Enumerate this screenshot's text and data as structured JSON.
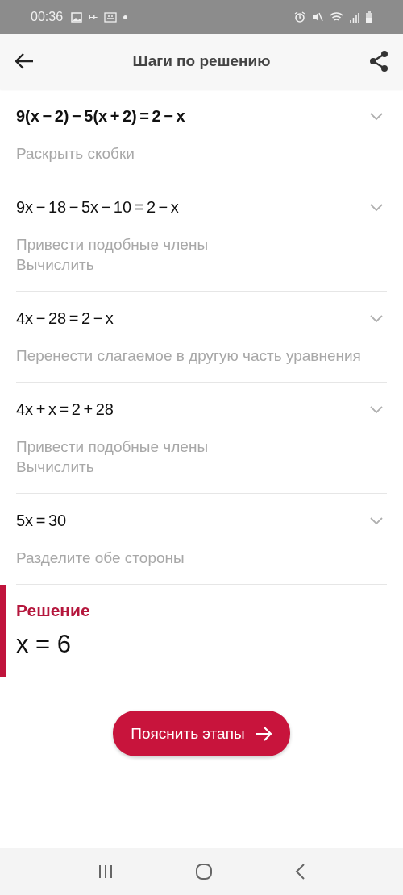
{
  "status_bar": {
    "time": "00:36",
    "app_badge": "FF"
  },
  "app_bar": {
    "title": "Шаги по решению"
  },
  "steps": [
    {
      "equation": "9(x − 2) − 5(x + 2) = 2 − x",
      "bold": true,
      "expanded": false,
      "descriptions": [
        "Раскрыть скобки"
      ]
    },
    {
      "equation": "9x − 18 − 5x − 10 = 2 − x",
      "bold": false,
      "expanded": false,
      "descriptions": [
        "Привести подобные члены",
        "Вычислить"
      ]
    },
    {
      "equation": "4x − 28 = 2 − x",
      "bold": false,
      "expanded": false,
      "descriptions": [
        "Перенести слагаемое в другую часть уравнения"
      ]
    },
    {
      "equation": "4x + x = 2 + 28",
      "bold": false,
      "expanded": false,
      "descriptions": [
        "Привести подобные члены",
        "Вычислить"
      ]
    },
    {
      "equation": "5x = 30",
      "bold": false,
      "expanded": false,
      "descriptions": [
        "Разделите обе стороны"
      ]
    }
  ],
  "solution": {
    "heading": "Решение",
    "answer": "x = 6"
  },
  "explain_button": {
    "label": "Пояснить этапы"
  }
}
